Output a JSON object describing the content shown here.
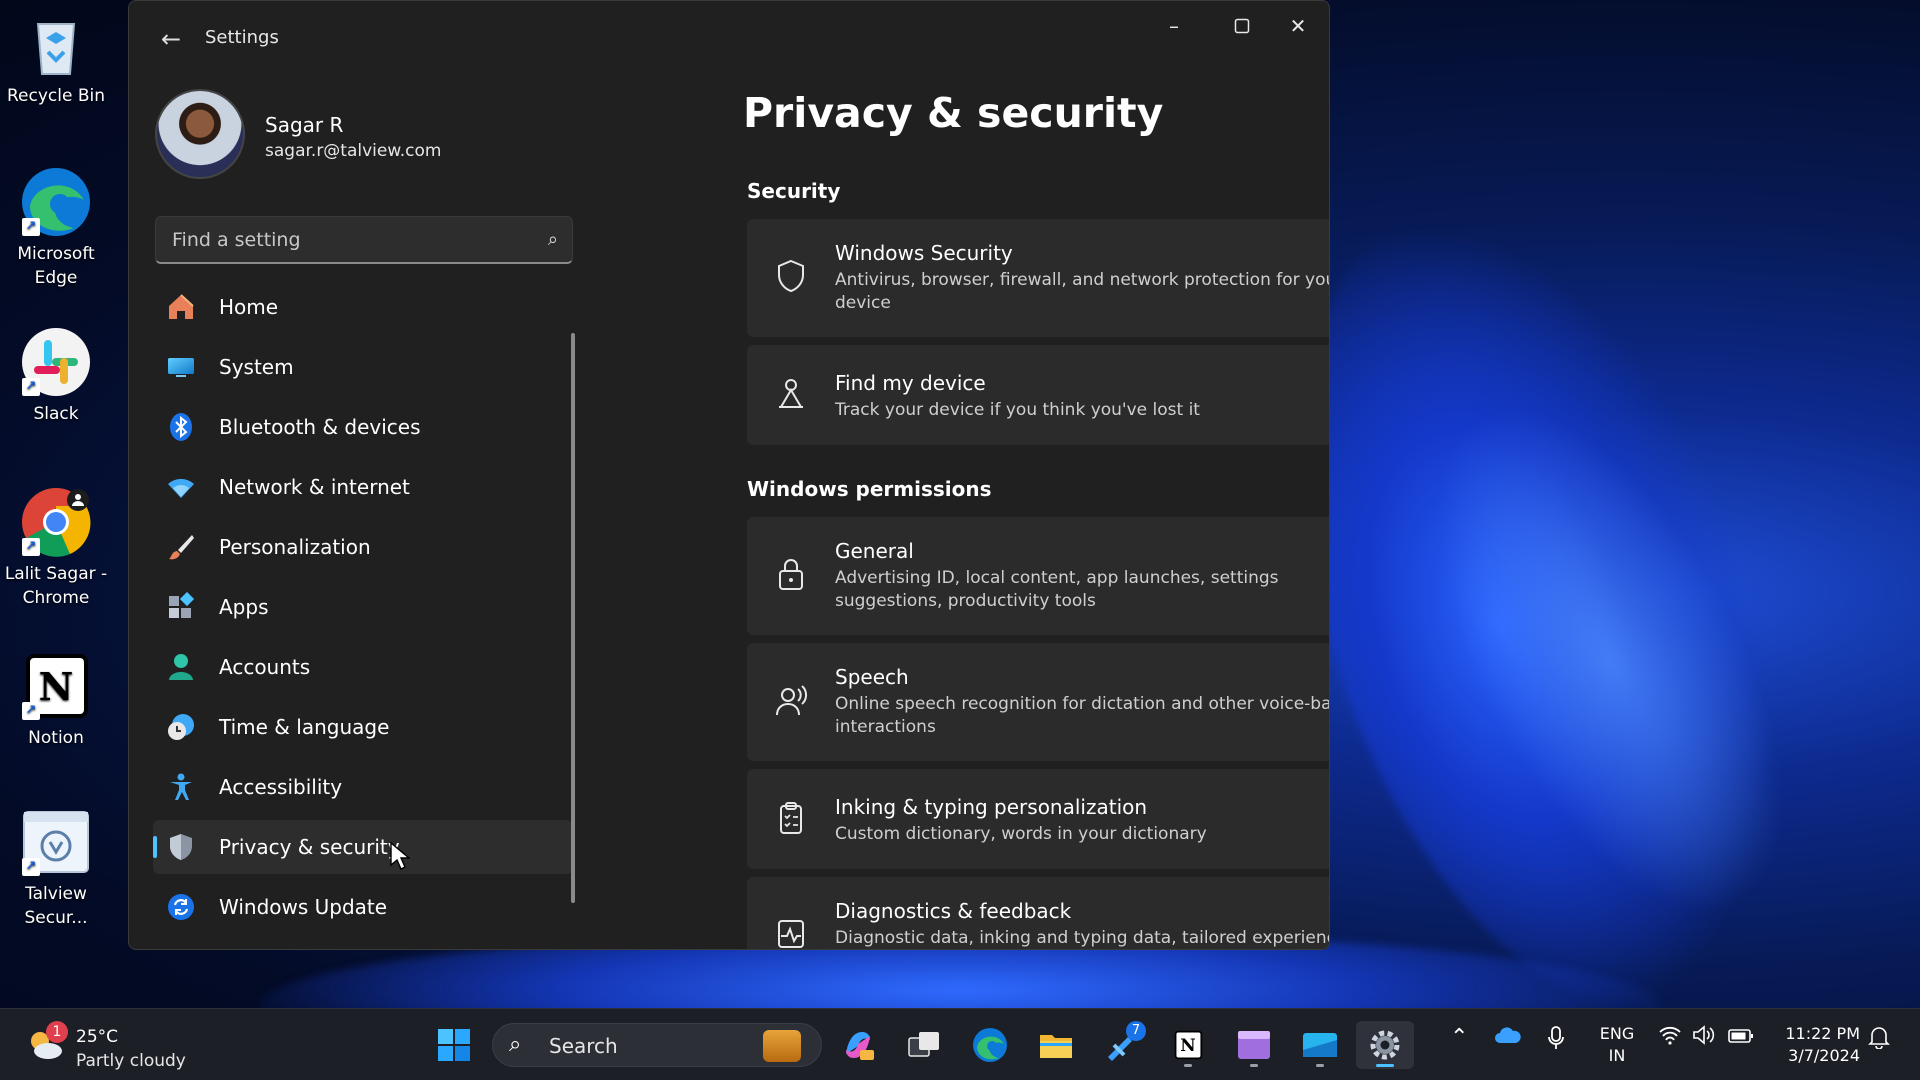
{
  "desktop": {
    "icons": [
      {
        "label": "Recycle Bin",
        "icon": "recycle-bin-icon"
      },
      {
        "label": "Microsoft Edge",
        "icon": "edge-icon"
      },
      {
        "label": "Slack",
        "icon": "slack-icon"
      },
      {
        "label": "Lalit Sagar - Chrome",
        "icon": "chrome-icon"
      },
      {
        "label": "Notion",
        "icon": "notion-icon"
      },
      {
        "label": "Talview Secur...",
        "icon": "talview-icon"
      }
    ]
  },
  "window": {
    "title": "Settings",
    "profile": {
      "name": "Sagar R",
      "email": "sagar.r@talview.com"
    },
    "search": {
      "placeholder": "Find a setting"
    },
    "nav": [
      {
        "label": "Home",
        "icon": "home-icon"
      },
      {
        "label": "System",
        "icon": "system-icon"
      },
      {
        "label": "Bluetooth & devices",
        "icon": "bluetooth-icon"
      },
      {
        "label": "Network & internet",
        "icon": "wifi-icon"
      },
      {
        "label": "Personalization",
        "icon": "brush-icon"
      },
      {
        "label": "Apps",
        "icon": "apps-icon"
      },
      {
        "label": "Accounts",
        "icon": "accounts-icon"
      },
      {
        "label": "Time & language",
        "icon": "clock-globe-icon"
      },
      {
        "label": "Accessibility",
        "icon": "accessibility-icon"
      },
      {
        "label": "Privacy & security",
        "icon": "shield-icon",
        "active": true
      },
      {
        "label": "Windows Update",
        "icon": "update-icon"
      }
    ],
    "page_title": "Privacy & security",
    "sections": [
      {
        "heading": "Security",
        "items": [
          {
            "title": "Windows Security",
            "desc": "Antivirus, browser, firewall, and network protection for your device",
            "icon": "shield-outline-icon"
          },
          {
            "title": "Find my device",
            "desc": "Track your device if you think you've lost it",
            "icon": "find-device-icon"
          }
        ]
      },
      {
        "heading": "Windows permissions",
        "items": [
          {
            "title": "General",
            "desc": "Advertising ID, local content, app launches, settings suggestions, productivity tools",
            "icon": "lock-icon"
          },
          {
            "title": "Speech",
            "desc": "Online speech recognition for dictation and other voice-based interactions",
            "icon": "speech-icon"
          },
          {
            "title": "Inking & typing personalization",
            "desc": "Custom dictionary, words in your dictionary",
            "icon": "clipboard-icon"
          },
          {
            "title": "Diagnostics & feedback",
            "desc": "Diagnostic data, inking and typing data, tailored experiences,",
            "icon": "pulse-icon"
          }
        ]
      }
    ]
  },
  "taskbar": {
    "weather": {
      "temp": "25°C",
      "condition": "Partly cloudy",
      "badge": "1"
    },
    "search_label": "Search",
    "lang": {
      "line1": "ENG",
      "line2": "IN"
    },
    "clock": {
      "time": "11:22 PM",
      "date": "3/7/2024"
    },
    "badge_count": "7"
  },
  "colors": {
    "accent": "#4cc2ff",
    "window_bg": "#202020",
    "card_bg": "#2b2b2b"
  }
}
